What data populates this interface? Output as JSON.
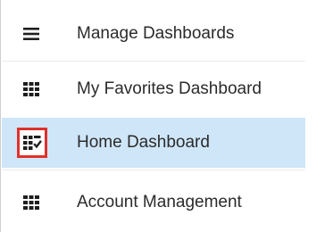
{
  "menu": {
    "items": [
      {
        "label": "Manage Dashboards",
        "icon": "hamburger-icon",
        "active": false,
        "icon_highlighted": false
      },
      {
        "label": "My Favorites Dashboard",
        "icon": "grid-icon",
        "active": false,
        "icon_highlighted": false
      },
      {
        "label": "Home Dashboard",
        "icon": "grid-check-icon",
        "active": true,
        "icon_highlighted": true
      },
      {
        "label": "Account Management",
        "icon": "grid-icon",
        "active": false,
        "icon_highlighted": false
      }
    ]
  },
  "colors": {
    "active_background": "#cfe6f8",
    "highlight_border": "#e0312a",
    "text": "#2b2b2b",
    "icon": "#1f1f1f"
  }
}
